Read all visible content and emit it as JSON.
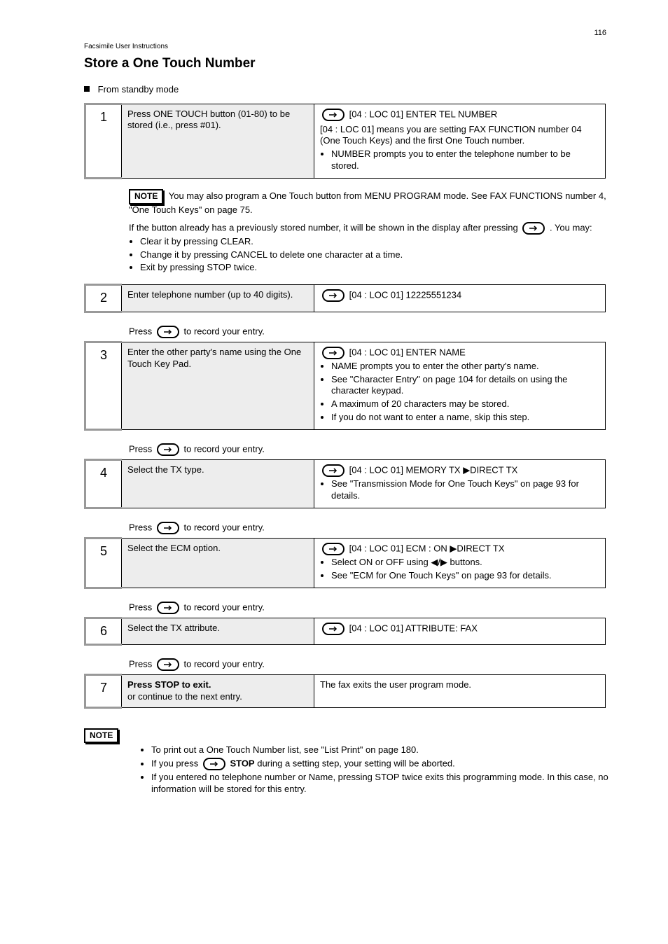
{
  "page_number": "116",
  "subtitle": "Facsimile User Instructions",
  "title": "Store a One Touch Number",
  "bullet_heading": "From standby mode",
  "steps": [
    {
      "num": "1",
      "mid": "Press ONE TOUCH button (01-80) to be stored (i.e., press #01).",
      "right_header": "[04 : LOC 01]  ENTER TEL NUMBER",
      "right_body": {
        "pre": "[04 : LOC 01] means you are setting\nFAX FUNCTION number 04 (One Touch Keys) and the first One Touch number.",
        "bullets": [
          "NUMBER prompts you to enter the telephone number to be stored."
        ]
      }
    },
    {
      "note": true,
      "text": "You may also program a One Touch button from MENU PROGRAM mode. See FAX FUNCTIONS number 4, \"One Touch Keys\" on page 75.",
      "after": "If the button already has a previously stored number, it will be shown in the display after pressing",
      "after2": ". You may:",
      "after_bullets": [
        "Clear it by pressing CLEAR.",
        "Change it by pressing CANCEL to delete one character at a time.",
        "Exit by pressing STOP twice."
      ]
    },
    {
      "num": "2",
      "mid": "Enter telephone number (up to 40 digits).",
      "right_header": "[04 : LOC 01]  12225551234"
    },
    {
      "num": "3",
      "section": "Press enter to record your entry.",
      "mid": "Enter the other party's name using the One Touch Key Pad.",
      "right_header": "[04 : LOC 01]  ENTER NAME",
      "right_body": {
        "bullets": [
          "NAME prompts you to enter the other party's name.",
          "See \"Character Entry\" on page 104 for details on using the character keypad.",
          "A maximum of 20 characters may be stored.",
          "If you do not want to enter a name, skip this step."
        ]
      }
    },
    {
      "num": "4",
      "section": "Press enter to record your entry.",
      "mid": "Select the TX type.",
      "right_header": "[04 : LOC 01]  MEMORY TX   ▶DIRECT TX",
      "right_body": {
        "bullets": [
          "See \"Transmission Mode for One Touch Keys\" on page 93 for details."
        ]
      }
    },
    {
      "num": "5",
      "section": "Press enter to record your entry.",
      "mid": "Select the ECM option.",
      "right_header": "[04 : LOC 01]  ECM : ON   ▶DIRECT TX",
      "right_body": {
        "bullets": [
          "Select ON or OFF using ◀/▶ buttons.",
          "See \"ECM for One Touch Keys\" on page 93 for details."
        ]
      }
    },
    {
      "num": "6",
      "section": "Press enter to record your entry.",
      "mid": "Select the TX attribute.",
      "right_header": "[04 : LOC 01]  ATTRIBUTE: FAX"
    },
    {
      "num": "7",
      "section": "Press enter to record your entry.",
      "mid_strong": "Press STOP to exit.",
      "mid_sub": "or continue to the next entry.",
      "right_body_plain": "The fax exits the user program mode."
    }
  ],
  "footer_note": {
    "label": "NOTE",
    "bullets": [
      "To print out a One Touch Number list, see \"List Print\" on page 180.",
      "If you press      during a setting step, your setting will be aborted.",
      "If you entered no telephone number or Name, pressing STOP twice exits this programming mode. In this case, no information will be stored for this entry."
    ],
    "enter_suffix": "STOP"
  },
  "labels": {
    "note": "NOTE",
    "press_enter": "Press",
    "to_record": "to record your entry."
  }
}
